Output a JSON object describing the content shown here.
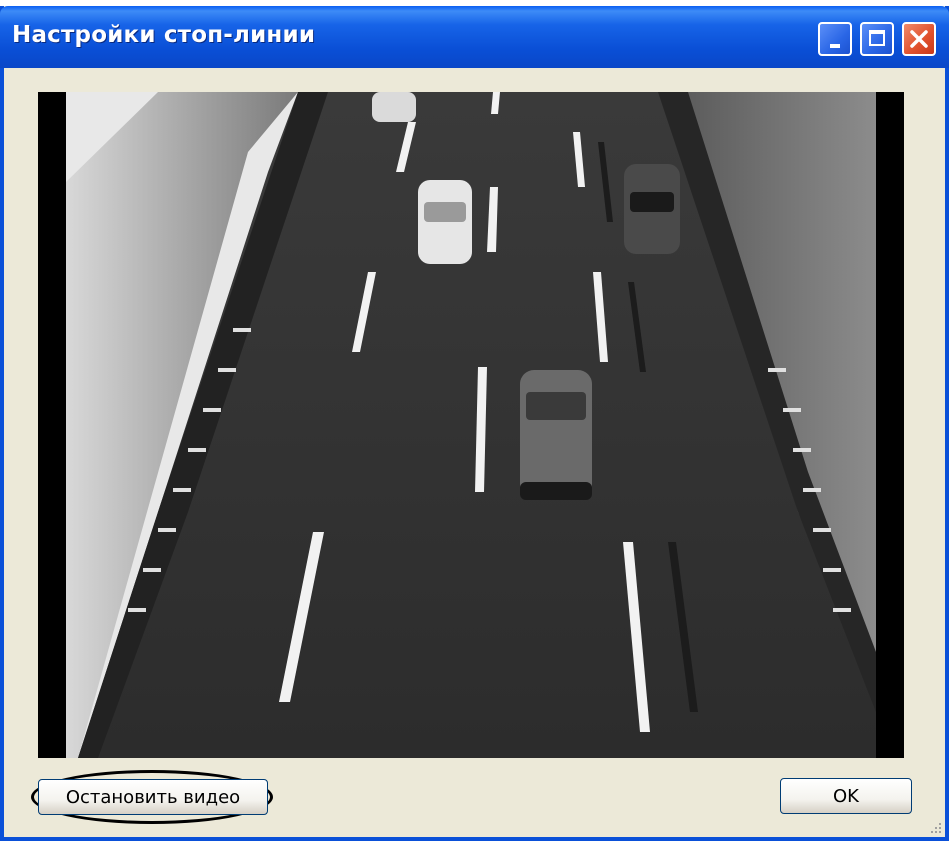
{
  "window": {
    "title": "Настройки стоп-линии",
    "controls": {
      "minimize": "minimize-icon",
      "maximize": "maximize-icon",
      "close": "close-icon"
    }
  },
  "video": {
    "description_icon": "video-preview"
  },
  "buttons": {
    "stop_video": "Остановить видео",
    "ok": "OK"
  },
  "colors": {
    "titlebar": "#0a4fd6",
    "window_bg": "#ece9d8",
    "close_button": "#e0502c"
  }
}
